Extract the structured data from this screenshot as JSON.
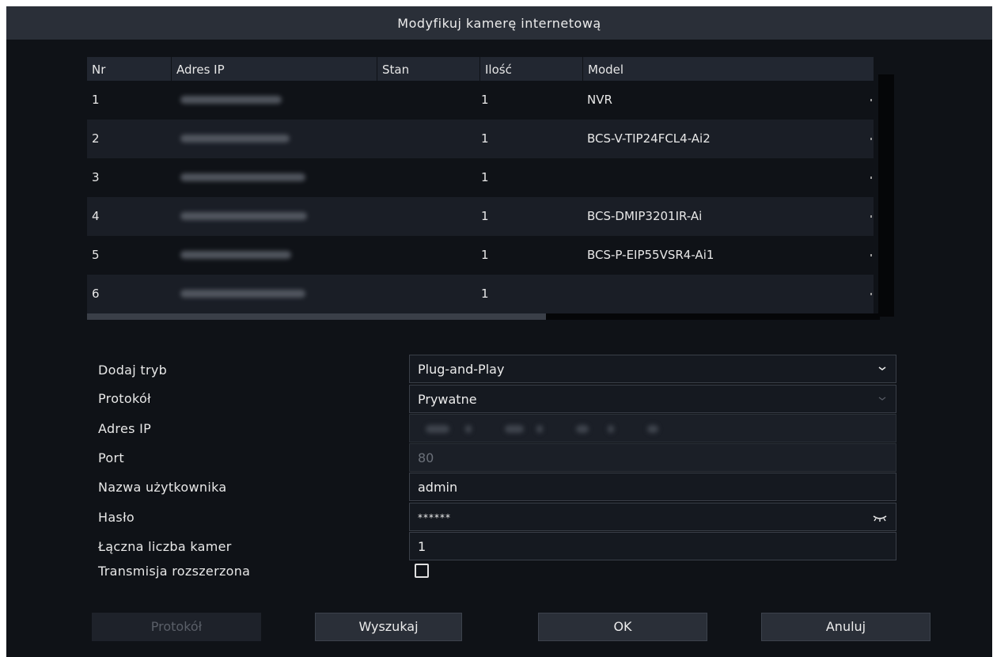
{
  "dialog": {
    "title": "Modyfikuj kamerę internetową"
  },
  "table": {
    "columns": [
      "Nr",
      "Adres IP",
      "Stan",
      "Ilość",
      "Model"
    ],
    "rows": [
      {
        "nr": "1",
        "ilosc": "1",
        "model": "NVR"
      },
      {
        "nr": "2",
        "ilosc": "1",
        "model": "BCS-V-TIP24FCL4-Ai2"
      },
      {
        "nr": "3",
        "ilosc": "1",
        "model": ""
      },
      {
        "nr": "4",
        "ilosc": "1",
        "model": "BCS-DMIP3201IR-Ai"
      },
      {
        "nr": "5",
        "ilosc": "1",
        "model": "BCS-P-EIP55VSR4-Ai1"
      },
      {
        "nr": "6",
        "ilosc": "1",
        "model": ""
      }
    ]
  },
  "form": {
    "labels": {
      "mode": "Dodaj tryb",
      "protocol": "Protokół",
      "ip": "Adres IP",
      "port": "Port",
      "username": "Nazwa użytkownika",
      "password": "Hasło",
      "camera_count": "Łączna liczba kamer",
      "extended_transmission": "Transmisja rozszerzona"
    },
    "values": {
      "mode": "Plug-and-Play",
      "protocol": "Prywatne",
      "port": "80",
      "username": "admin",
      "password": "******",
      "camera_count": "1"
    },
    "icons": {
      "mode_dropdown": "chevron-down-icon",
      "protocol_dropdown": "chevron-down-icon",
      "password_toggle": "eye-closed-icon"
    },
    "extended_transmission_checked": false
  },
  "buttons": {
    "protocol": "Protokół",
    "search": "Wyszukaj",
    "ok": "OK",
    "cancel": "Anuluj"
  },
  "colors": {
    "background": "#0f1217",
    "titlebar": "#2a2f38",
    "row_alt": "#1a1e26",
    "text": "#e8e8e8"
  }
}
